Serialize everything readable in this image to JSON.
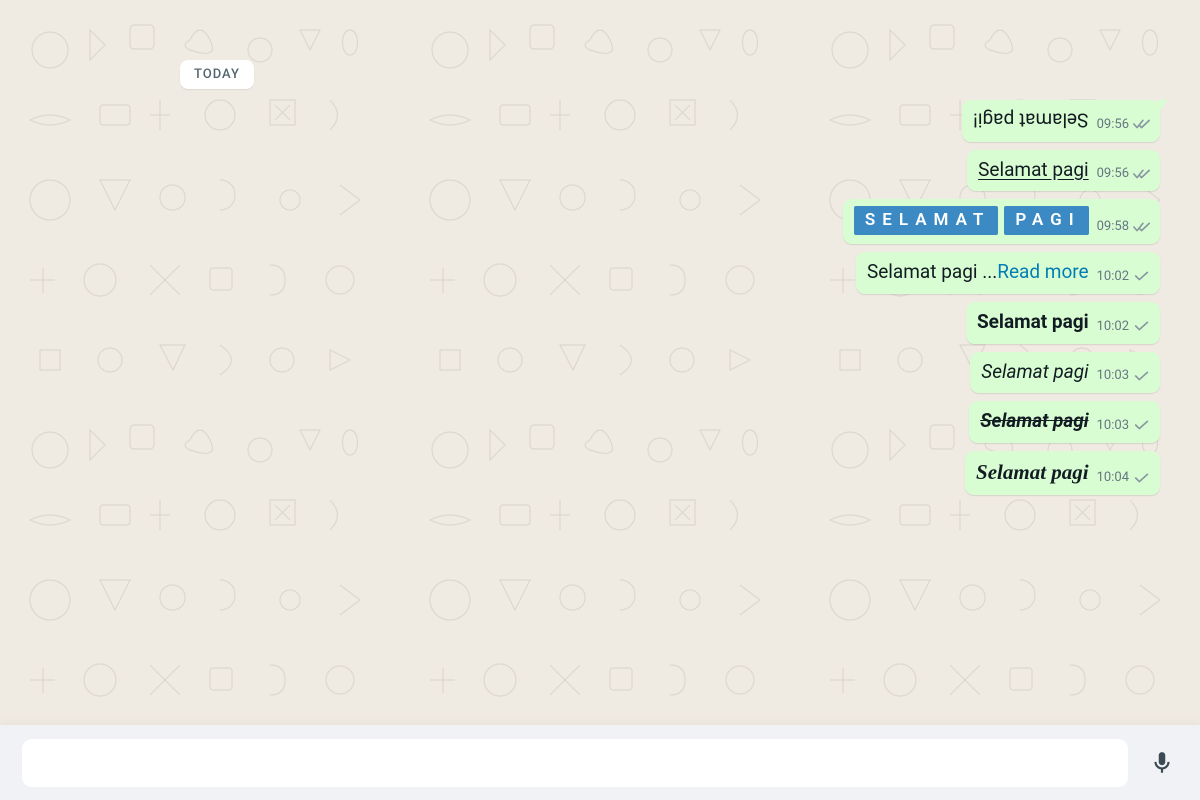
{
  "date_label": "TODAY",
  "messages": [
    {
      "text": "Selamat pagi!",
      "time": "09:56",
      "status": "delivered",
      "style": "upside-down"
    },
    {
      "text": "Selamat pagi",
      "time": "09:56",
      "status": "delivered",
      "style": "underline"
    },
    {
      "text_parts": [
        "SELAMAT",
        "PAGI"
      ],
      "time": "09:58",
      "status": "delivered",
      "style": "highlight"
    },
    {
      "text": "Selamat pagi ...",
      "read_more": "Read more",
      "time": "10:02",
      "status": "sent",
      "style": "readmore"
    },
    {
      "text": "Selamat pagi",
      "time": "10:02",
      "status": "sent",
      "style": "bold"
    },
    {
      "text": "Selamat pagi",
      "time": "10:03",
      "status": "sent",
      "style": "italic"
    },
    {
      "text": "Selamat pagi",
      "time": "10:03",
      "status": "sent",
      "style": "strike"
    },
    {
      "text": "Selamat pagi",
      "time": "10:04",
      "status": "sent",
      "style": "script"
    }
  ],
  "input": {
    "placeholder": ""
  },
  "icons": {
    "mic": "microphone-icon",
    "check": "check-icon",
    "double_check": "double-check-icon"
  }
}
